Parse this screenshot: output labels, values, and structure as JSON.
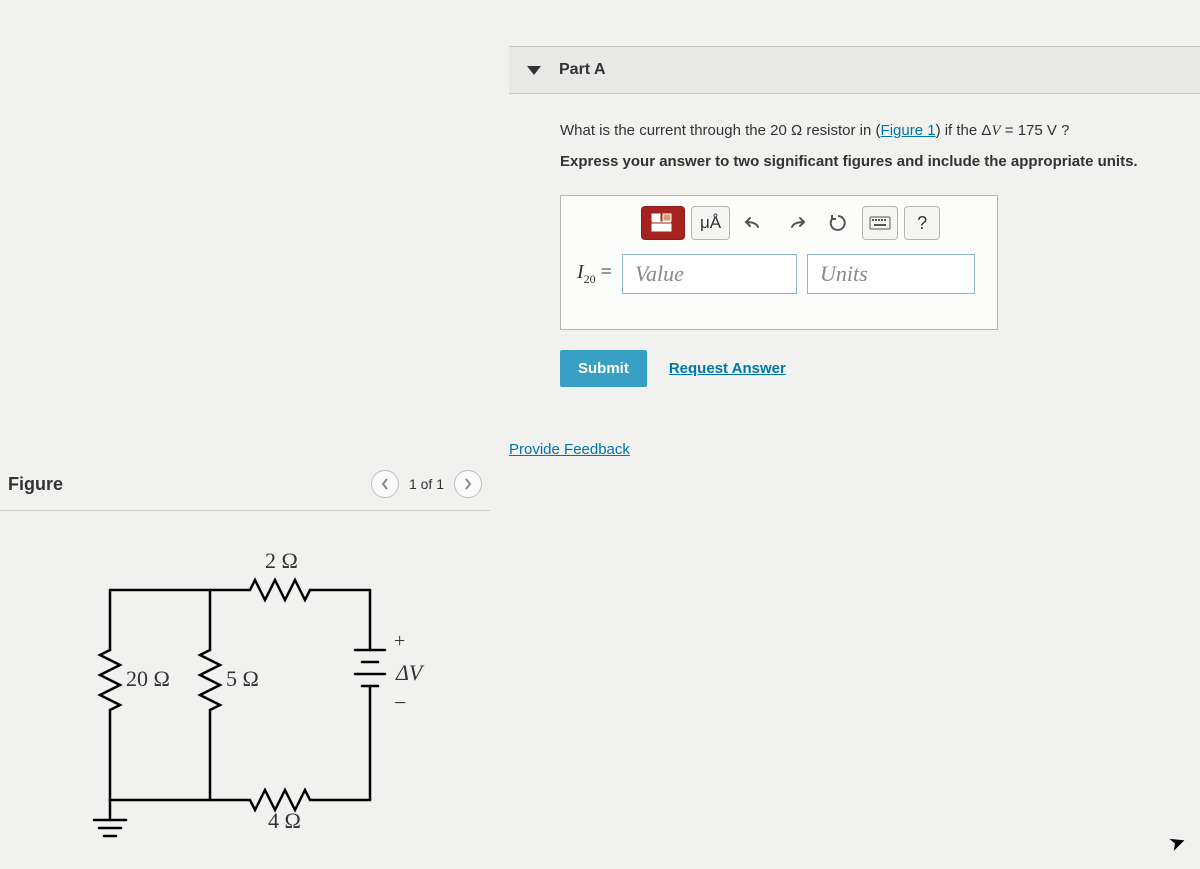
{
  "part": {
    "title": "Part A"
  },
  "question": {
    "prefix": "What is the current through the 20 Ω resistor in (",
    "figlink": "Figure 1",
    "mid": ") if the Δ",
    "var": "V",
    "suffix": " = 175  V ?",
    "instruction": "Express your answer to two significant figures and include the appropriate units."
  },
  "toolbar": {
    "units_btn": "μÅ",
    "help": "?"
  },
  "answer": {
    "lhs_var": "I",
    "lhs_sub": "20",
    "lhs_eq": " = ",
    "value_placeholder": "Value",
    "units_placeholder": "Units"
  },
  "actions": {
    "submit": "Submit",
    "request": "Request Answer"
  },
  "feedback": "Provide Feedback",
  "figure": {
    "title": "Figure",
    "counter": "1 of 1"
  },
  "circuit": {
    "r_top": "2 Ω",
    "r_left": "20 Ω",
    "r_mid": "5 Ω",
    "r_bottom": "4 Ω",
    "plus": "+",
    "minus": "−",
    "dv": "ΔV"
  }
}
